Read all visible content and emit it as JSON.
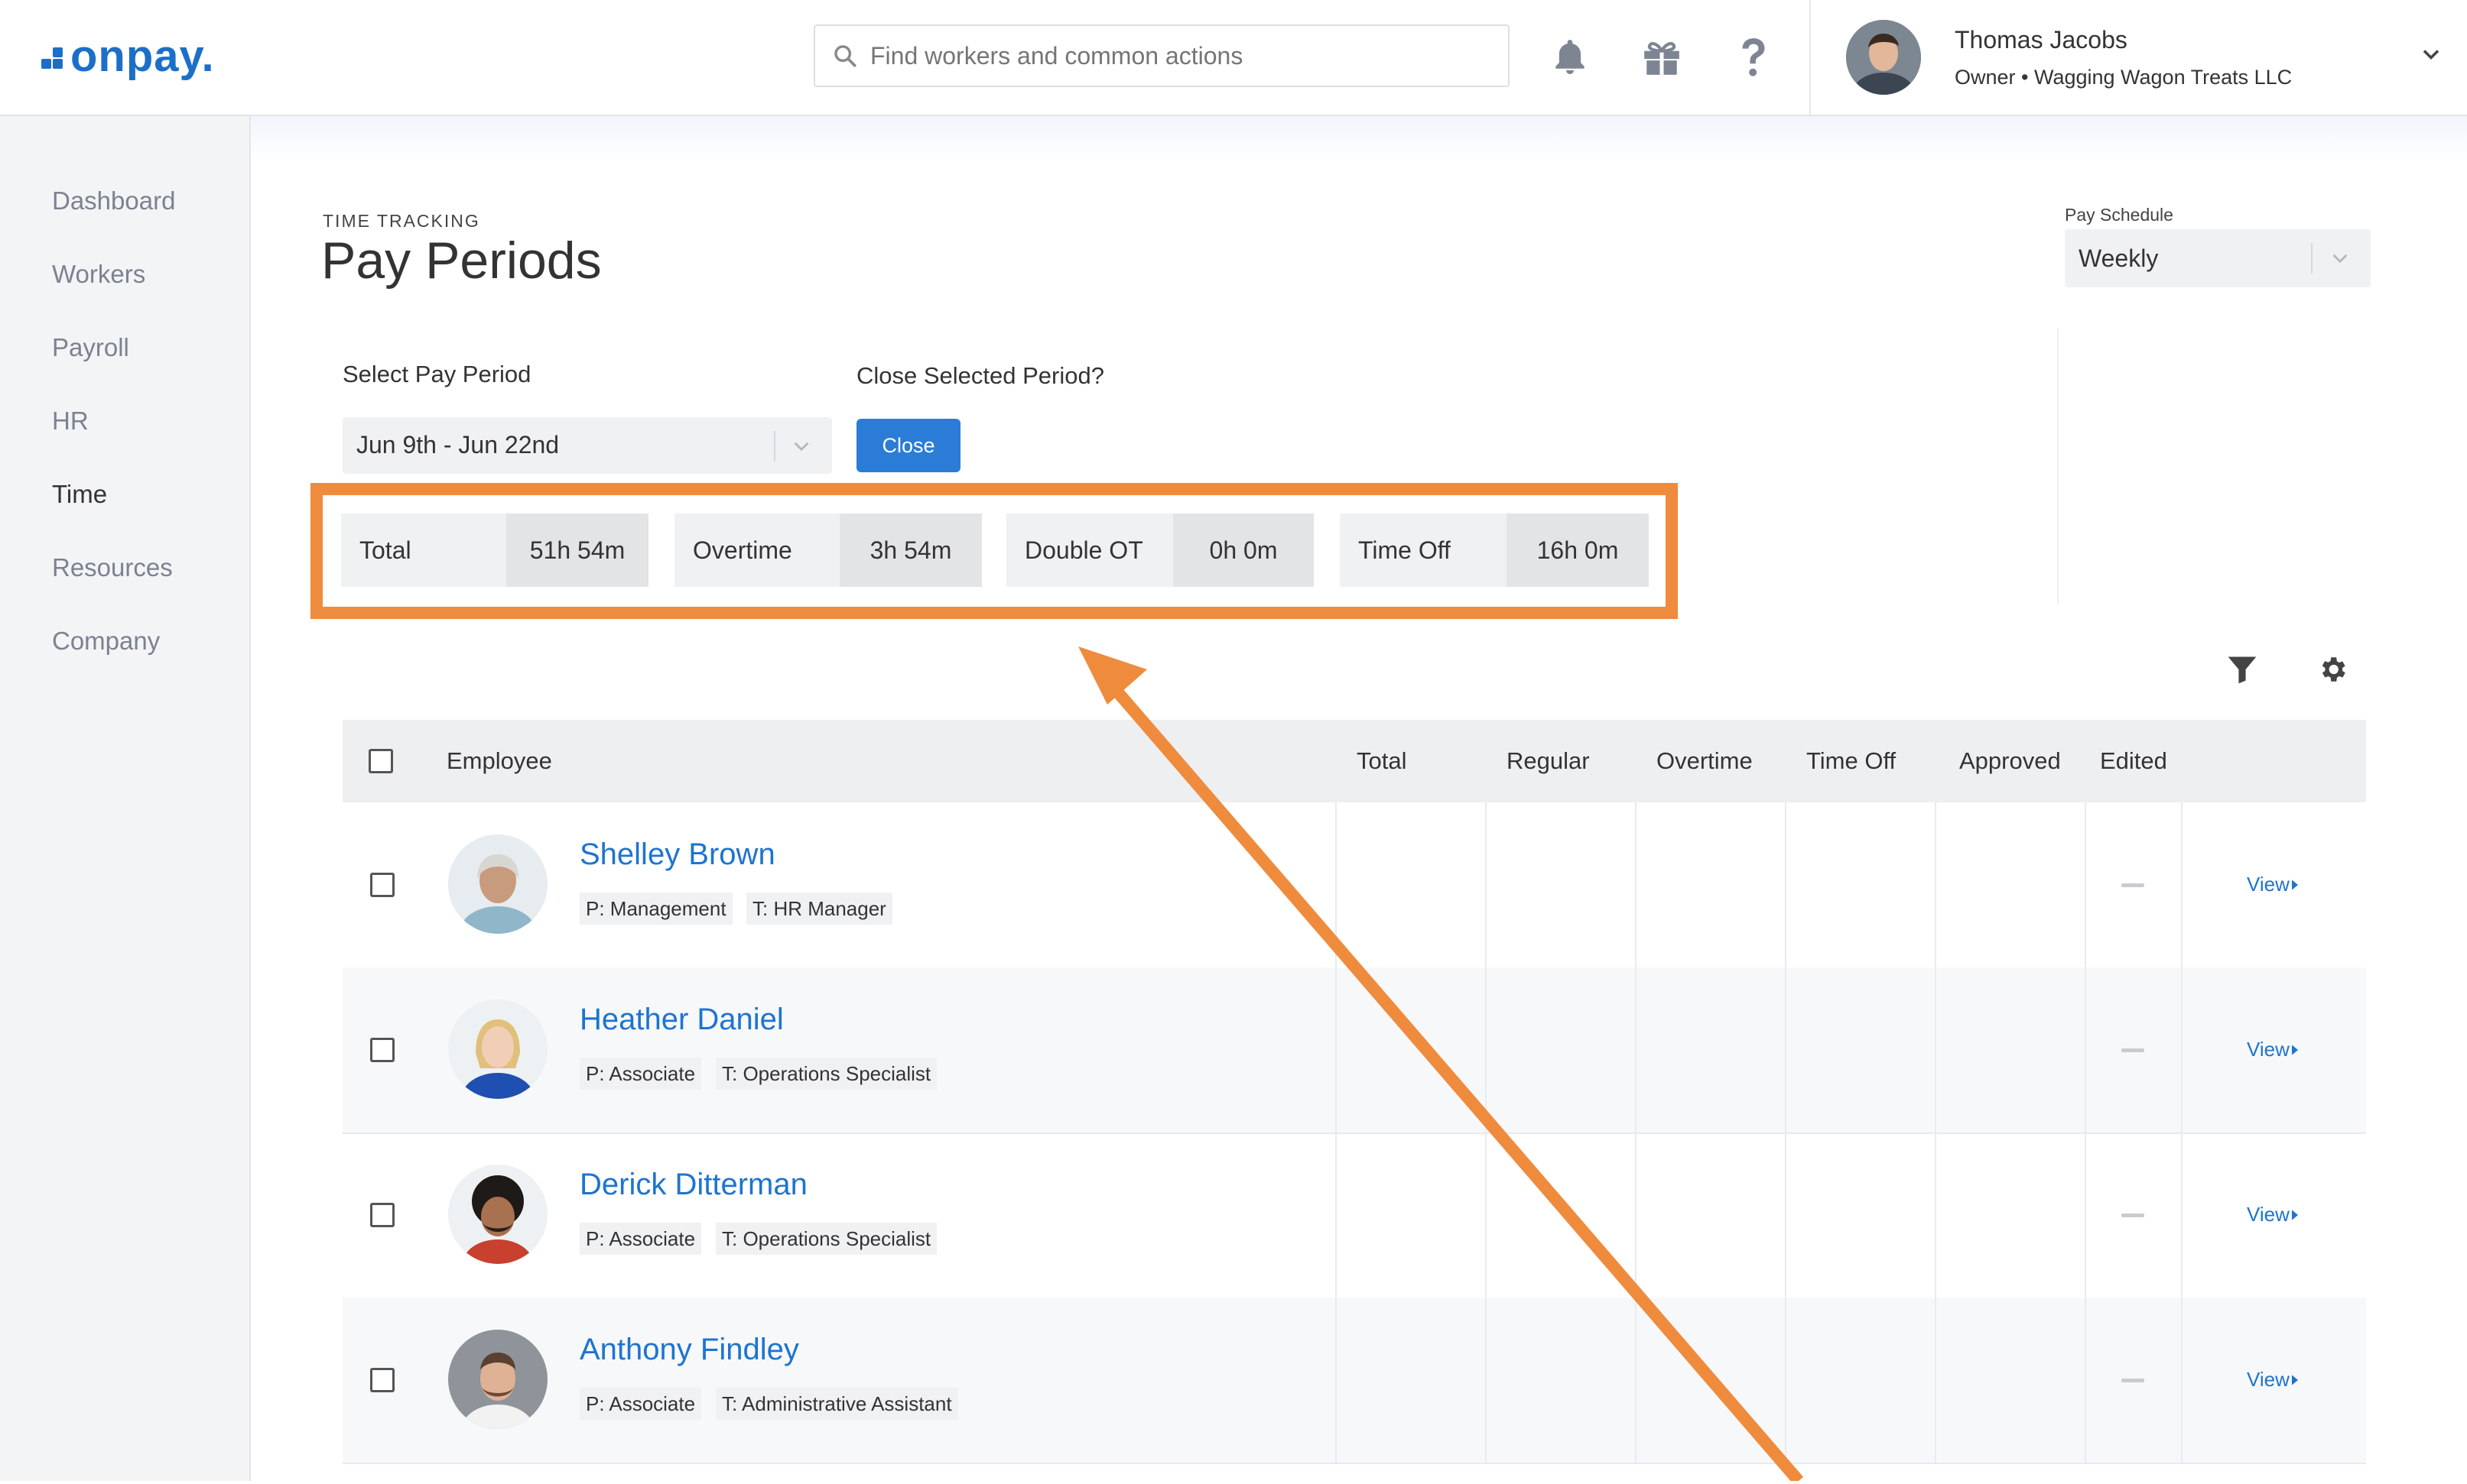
{
  "header": {
    "logo_text": "onpay.",
    "search_placeholder": "Find workers and common actions",
    "user": {
      "name": "Thomas Jacobs",
      "role": "Owner • Wagging Wagon Treats LLC"
    }
  },
  "sidebar": {
    "items": [
      {
        "label": "Dashboard"
      },
      {
        "label": "Workers"
      },
      {
        "label": "Payroll"
      },
      {
        "label": "HR"
      },
      {
        "label": "Time"
      },
      {
        "label": "Resources"
      },
      {
        "label": "Company"
      }
    ],
    "active": "Time"
  },
  "page": {
    "eyebrow": "TIME TRACKING",
    "title": "Pay Periods",
    "pay_schedule_label": "Pay Schedule",
    "pay_schedule_value": "Weekly",
    "select_period_label": "Select Pay Period",
    "selected_period": "Jun 9th - Jun 22nd",
    "close_question": "Close Selected Period?",
    "close_button": "Close"
  },
  "stats": [
    {
      "label": "Total",
      "value": "51h 54m"
    },
    {
      "label": "Overtime",
      "value": "3h 54m"
    },
    {
      "label": "Double OT",
      "value": "0h 0m"
    },
    {
      "label": "Time Off",
      "value": "16h 0m"
    }
  ],
  "table": {
    "columns": [
      "Employee",
      "Total",
      "Regular",
      "Overtime",
      "Time Off",
      "Approved",
      "Edited"
    ],
    "rows": [
      {
        "name": "Shelley Brown",
        "position": "P: Management",
        "title": "T: HR Manager",
        "view": "View"
      },
      {
        "name": "Heather Daniel",
        "position": "P: Associate",
        "title": "T: Operations Specialist",
        "view": "View"
      },
      {
        "name": "Derick Ditterman",
        "position": "P: Associate",
        "title": "T: Operations Specialist",
        "view": "View"
      },
      {
        "name": "Anthony Findley",
        "position": "P: Associate",
        "title": "T: Administrative Assistant",
        "view": "View"
      }
    ]
  },
  "colors": {
    "brand": "#1c6fc9",
    "link": "#1d74d0",
    "annotation": "#ef8b3d"
  },
  "icons": [
    "search-icon",
    "bell-icon",
    "gift-icon",
    "help-icon",
    "chevron-down-icon",
    "filter-icon",
    "gear-icon",
    "caret-right-icon"
  ]
}
